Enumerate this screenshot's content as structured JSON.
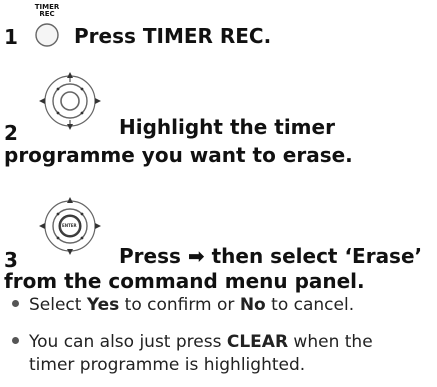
{
  "step1": {
    "number": "1",
    "button_label_line1": "TIMER",
    "button_label_line2": "REC",
    "text": "Press TIMER REC."
  },
  "step2": {
    "number": "2",
    "text_line1": "Highlight the timer",
    "text_line2": "programme you want to erase."
  },
  "step3": {
    "number": "3",
    "text_before_arrow": "Press",
    "arrow": "➡",
    "text_after_arrow": "then select ‘Erase’",
    "text_line2": "from the command menu panel.",
    "enter_label": "ENTER"
  },
  "bullets": [
    {
      "pre": "Select ",
      "b1": "Yes",
      "mid": " to confirm or ",
      "b2": "No",
      "post": " to cancel."
    },
    {
      "pre": "You can also just press ",
      "b1": "CLEAR",
      "mid": " when the",
      "line2": "timer programme is highlighted."
    }
  ]
}
